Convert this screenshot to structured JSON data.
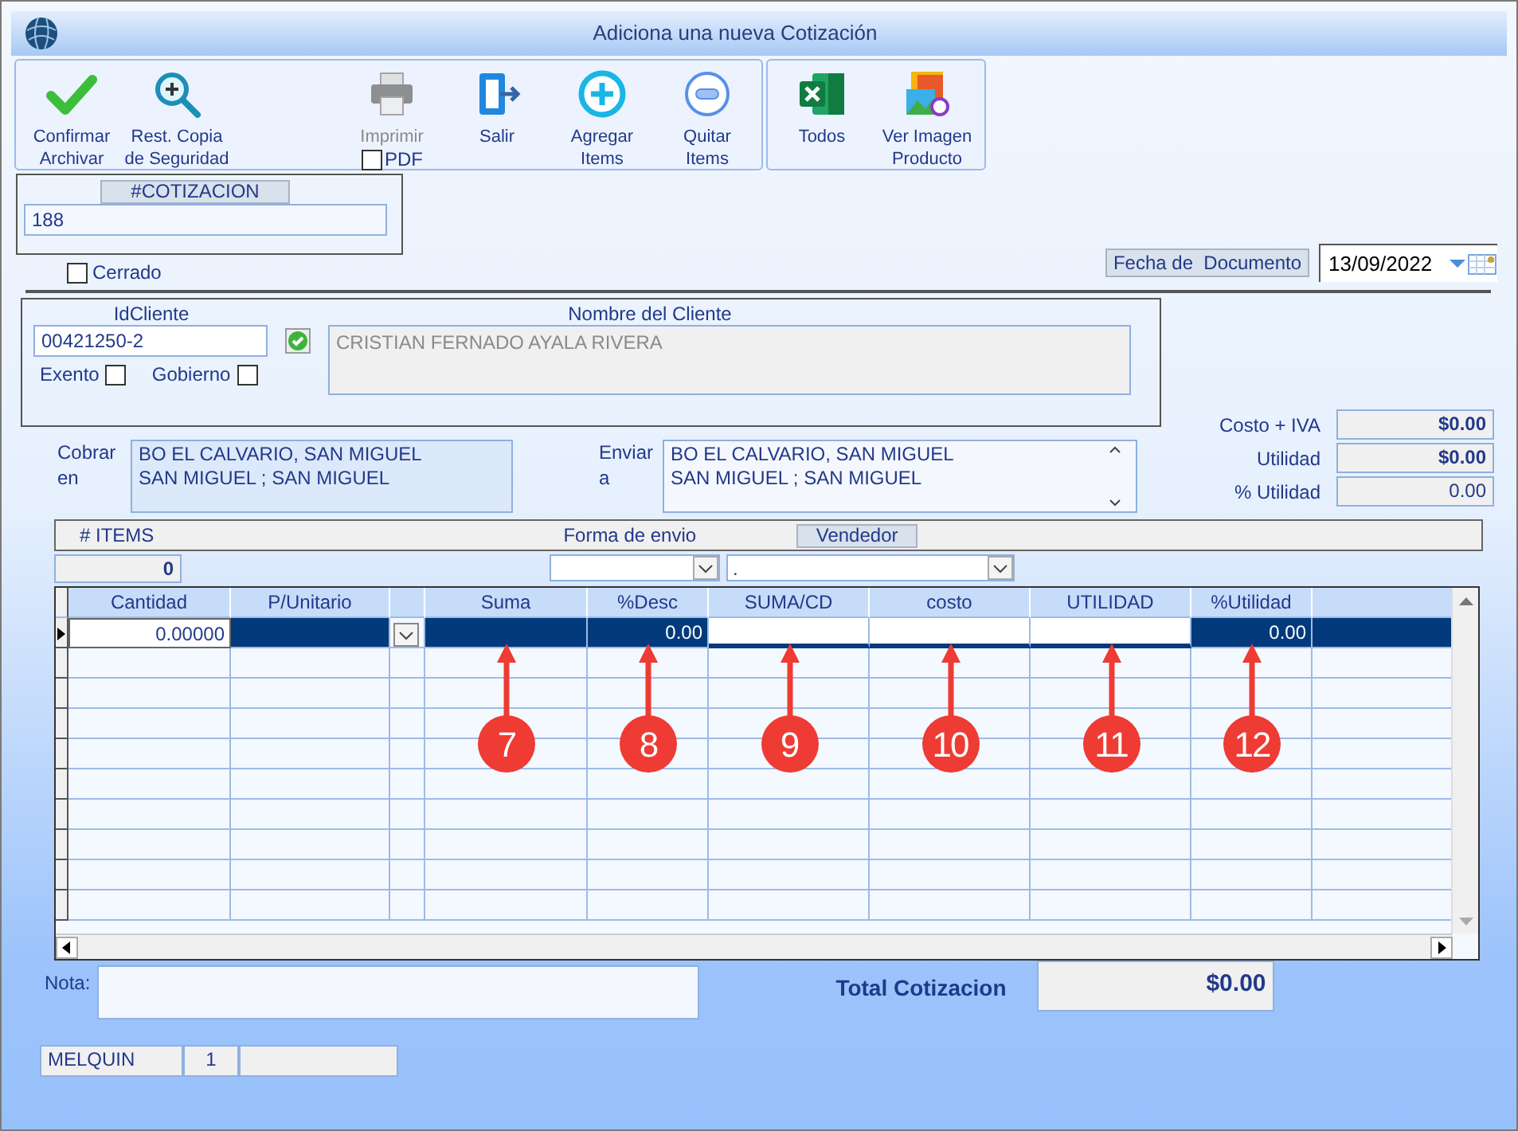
{
  "window": {
    "title": "Adiciona una nueva Cotización"
  },
  "toolbar": [
    {
      "buttons": [
        {
          "kind": "check",
          "label": "Confirmar\nArchivar",
          "disabled": false
        },
        {
          "kind": "restore",
          "label": "Rest. Copia\nde Seguridad",
          "disabled": false
        },
        {
          "kind": "print",
          "label": "Imprimir",
          "disabled": true,
          "option": {
            "label": "PDF",
            "checked": false
          }
        },
        {
          "kind": "exit",
          "label": "Salir",
          "disabled": false
        },
        {
          "kind": "add",
          "label": "Agregar\nItems",
          "disabled": false
        },
        {
          "kind": "remove",
          "label": "Quitar\nItems",
          "disabled": false
        }
      ]
    },
    {
      "buttons": [
        {
          "kind": "excel",
          "label": "Todos",
          "disabled": false
        },
        {
          "kind": "image",
          "label": "Ver Imagen\nProducto",
          "disabled": false
        }
      ]
    }
  ],
  "cotizacion": {
    "label": "#COTIZACION",
    "value": "188"
  },
  "cerrado": {
    "label": "Cerrado",
    "checked": false
  },
  "fecha": {
    "label": "Fecha de  Documento",
    "value": "13/09/2022"
  },
  "cliente": {
    "id_label": "IdCliente",
    "id": "00421250-2",
    "name_label": "Nombre del Cliente",
    "name": "CRISTIAN FERNADO AYALA RIVERA",
    "flags": [
      {
        "label": "Exento",
        "checked": false
      },
      {
        "label": "Gobierno",
        "checked": false
      }
    ]
  },
  "cobrar": {
    "label": "Cobrar\nen",
    "lines": [
      "BO EL CALVARIO, SAN MIGUEL",
      "SAN MIGUEL ; SAN MIGUEL"
    ]
  },
  "enviar": {
    "label": "Enviar\na",
    "lines": [
      "BO EL CALVARIO, SAN MIGUEL",
      "SAN MIGUEL ; SAN MIGUEL"
    ]
  },
  "totals": [
    {
      "label": "Costo + IVA",
      "value": "$0.00",
      "kind": "money"
    },
    {
      "label": "Utilidad",
      "value": "$0.00",
      "kind": "money"
    },
    {
      "label": "% Utilidad",
      "value": "0.00",
      "kind": "percent"
    }
  ],
  "items_bar": {
    "items_label": "# ITEMS",
    "items_value": "0",
    "envio_label": "Forma de envio",
    "vendedor_label": "Vendedor",
    "vendedor_value": "."
  },
  "grid": {
    "columns": [
      {
        "label": "Cantidad"
      },
      {
        "label": "P/Unitario"
      },
      {
        "kind": "dropdown"
      },
      {
        "label": "Suma"
      },
      {
        "label": "%Desc"
      },
      {
        "label": "SUMA/CD"
      },
      {
        "label": "costo"
      },
      {
        "label": "UTILIDAD"
      },
      {
        "label": "%Utilidad"
      }
    ],
    "rows": [
      {
        "selected": true,
        "cells": [
          {
            "value": "0.00000",
            "editing": true
          },
          {
            "editing": false
          },
          {
            "editing": false
          },
          {
            "editing": false
          },
          {
            "value": "0.00",
            "editing": false
          },
          {
            "editing": true
          },
          {
            "editing": true
          },
          {
            "editing": true
          },
          {
            "value": "0.00",
            "editing": false
          }
        ]
      }
    ]
  },
  "callouts": [
    "7",
    "8",
    "9",
    "10",
    "11",
    "12"
  ],
  "nota": {
    "label": "Nota:"
  },
  "total": {
    "label": "Total Cotizacion",
    "value": "$0.00"
  },
  "status_bar": [
    "MELQUIN",
    "1"
  ]
}
